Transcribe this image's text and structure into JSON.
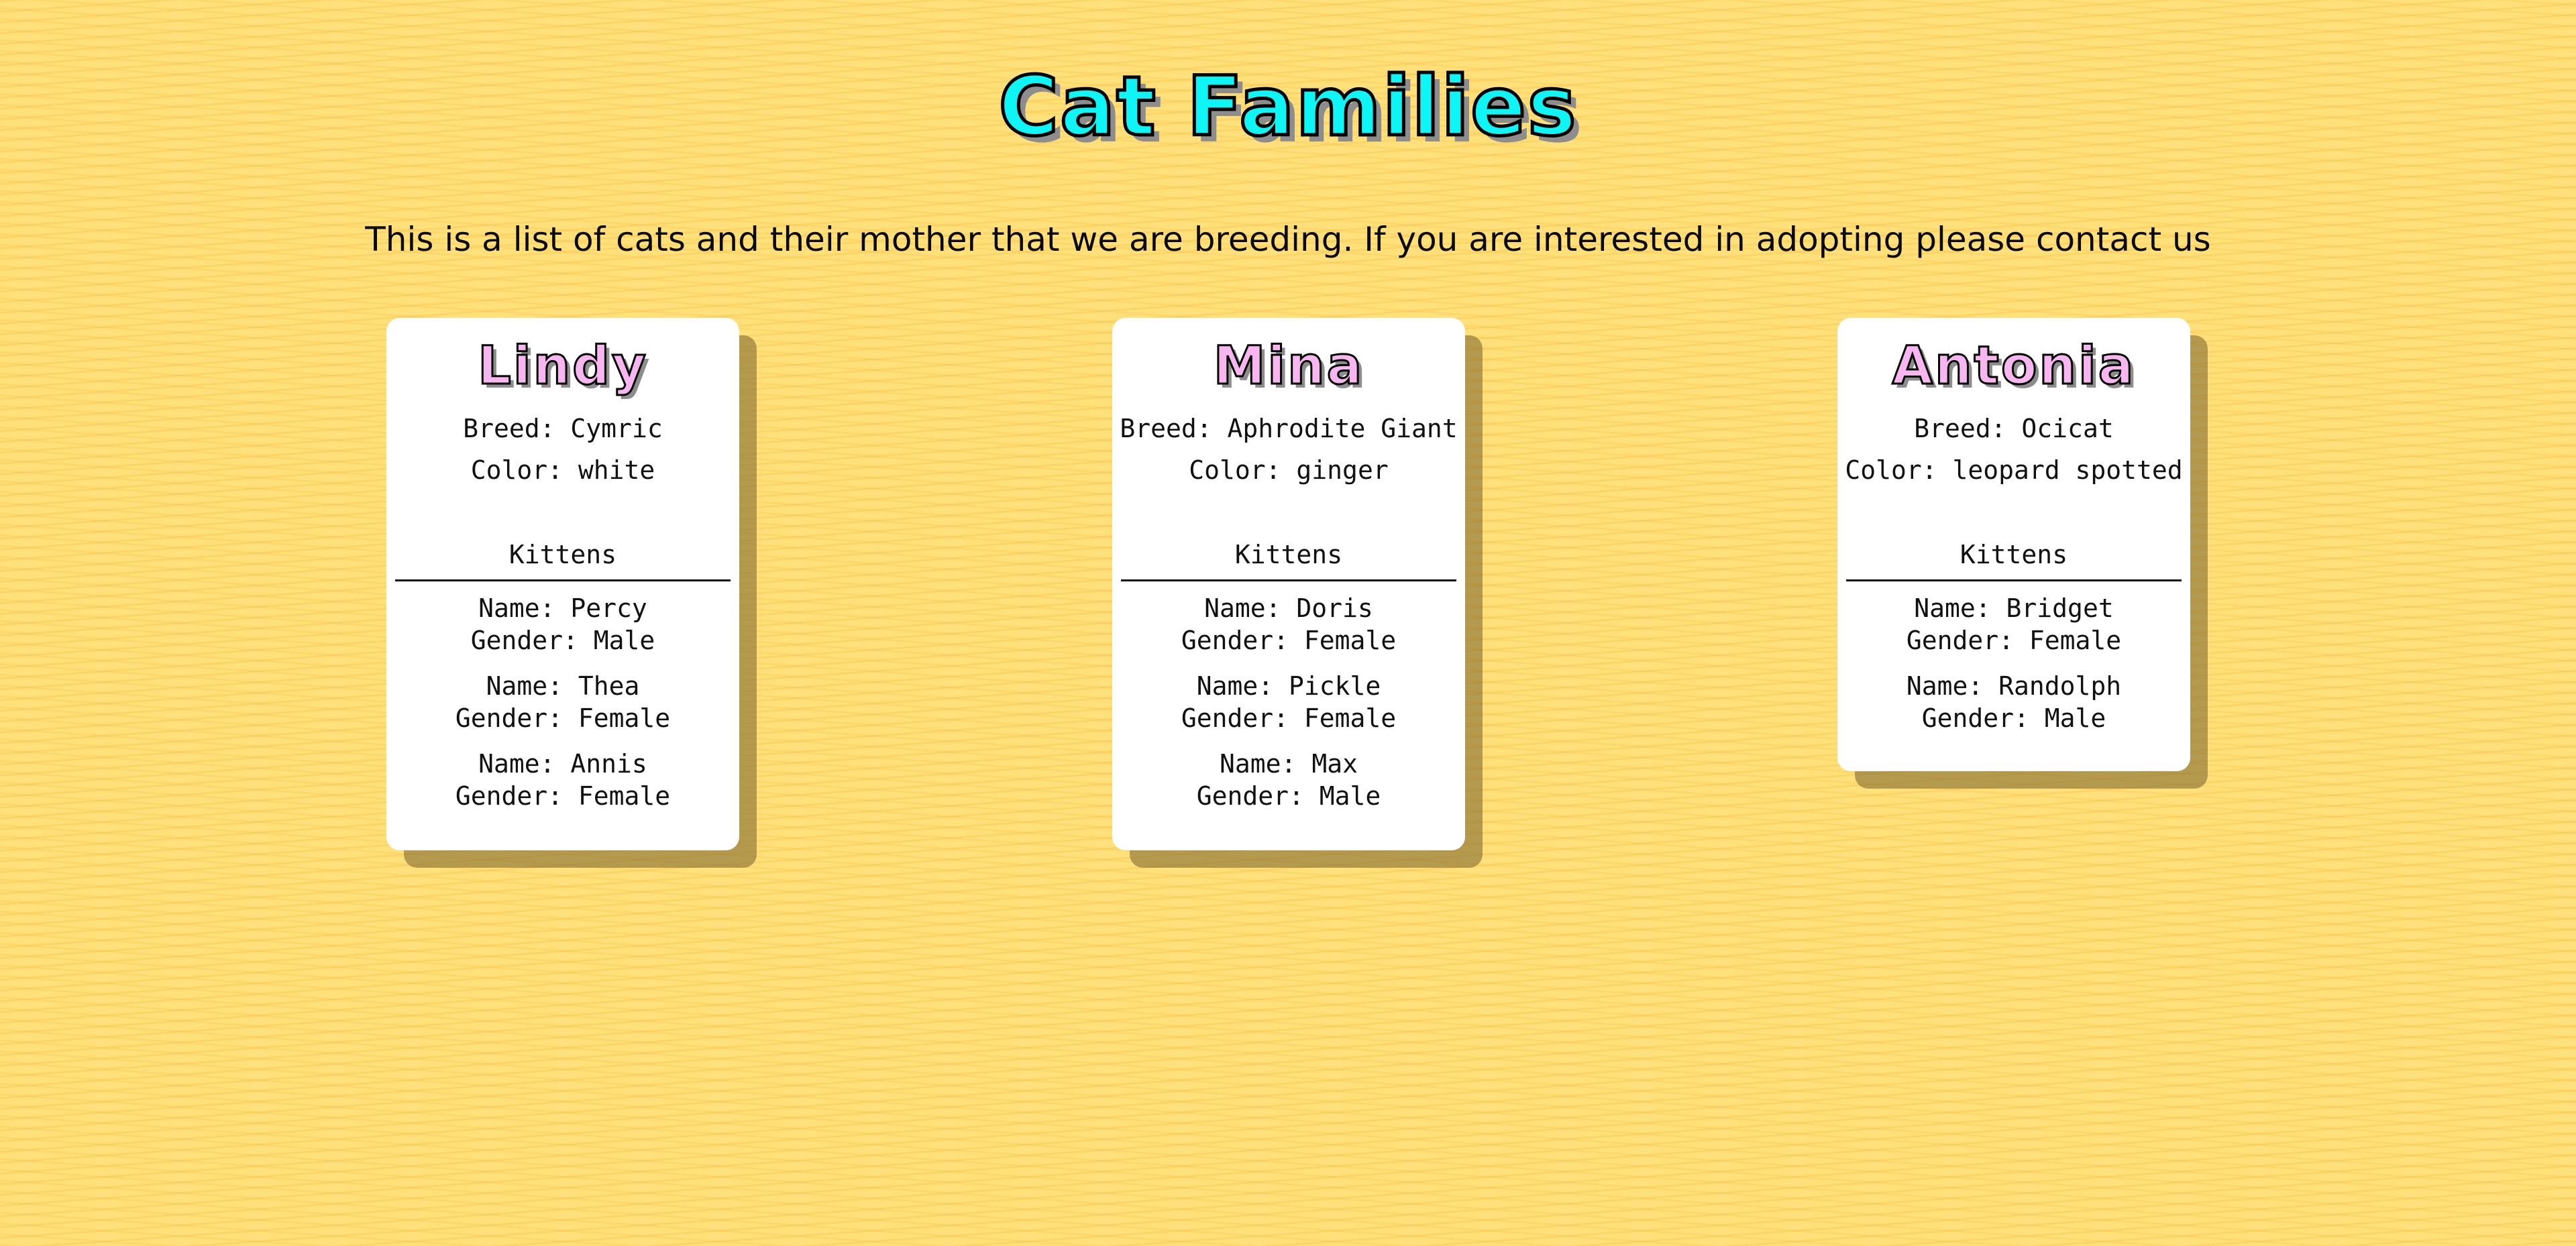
{
  "page": {
    "title": "Cat Families",
    "intro": "This is a list of cats and their mother that we are breeding. If you are interested in adopting please contact us"
  },
  "cats": [
    {
      "name": "Lindy",
      "breed": "Breed: Cymric",
      "color": "Color: white",
      "kittens_heading": "Kittens",
      "kittens": [
        {
          "name": "Name: Percy",
          "gender": "Gender: Male"
        },
        {
          "name": "Name: Thea",
          "gender": "Gender: Female"
        },
        {
          "name": "Name: Annis",
          "gender": "Gender: Female"
        }
      ]
    },
    {
      "name": "Mina",
      "breed": "Breed: Aphrodite Giant",
      "color": "Color: ginger",
      "kittens_heading": "Kittens",
      "kittens": [
        {
          "name": "Name: Doris",
          "gender": "Gender: Female"
        },
        {
          "name": "Name: Pickle",
          "gender": "Gender: Female"
        },
        {
          "name": "Name: Max",
          "gender": "Gender: Male"
        }
      ]
    },
    {
      "name": "Antonia",
      "breed": "Breed: Ocicat",
      "color": "Color: leopard spotted",
      "kittens_heading": "Kittens",
      "kittens": [
        {
          "name": "Name: Bridget",
          "gender": "Gender: Female"
        },
        {
          "name": "Name: Randolph",
          "gender": "Gender: Male"
        }
      ]
    }
  ],
  "colors": {
    "background": "#ffe07a",
    "title": "#0ff4f4",
    "cat_name": "#f7b6f0",
    "card": "#ffffff"
  }
}
